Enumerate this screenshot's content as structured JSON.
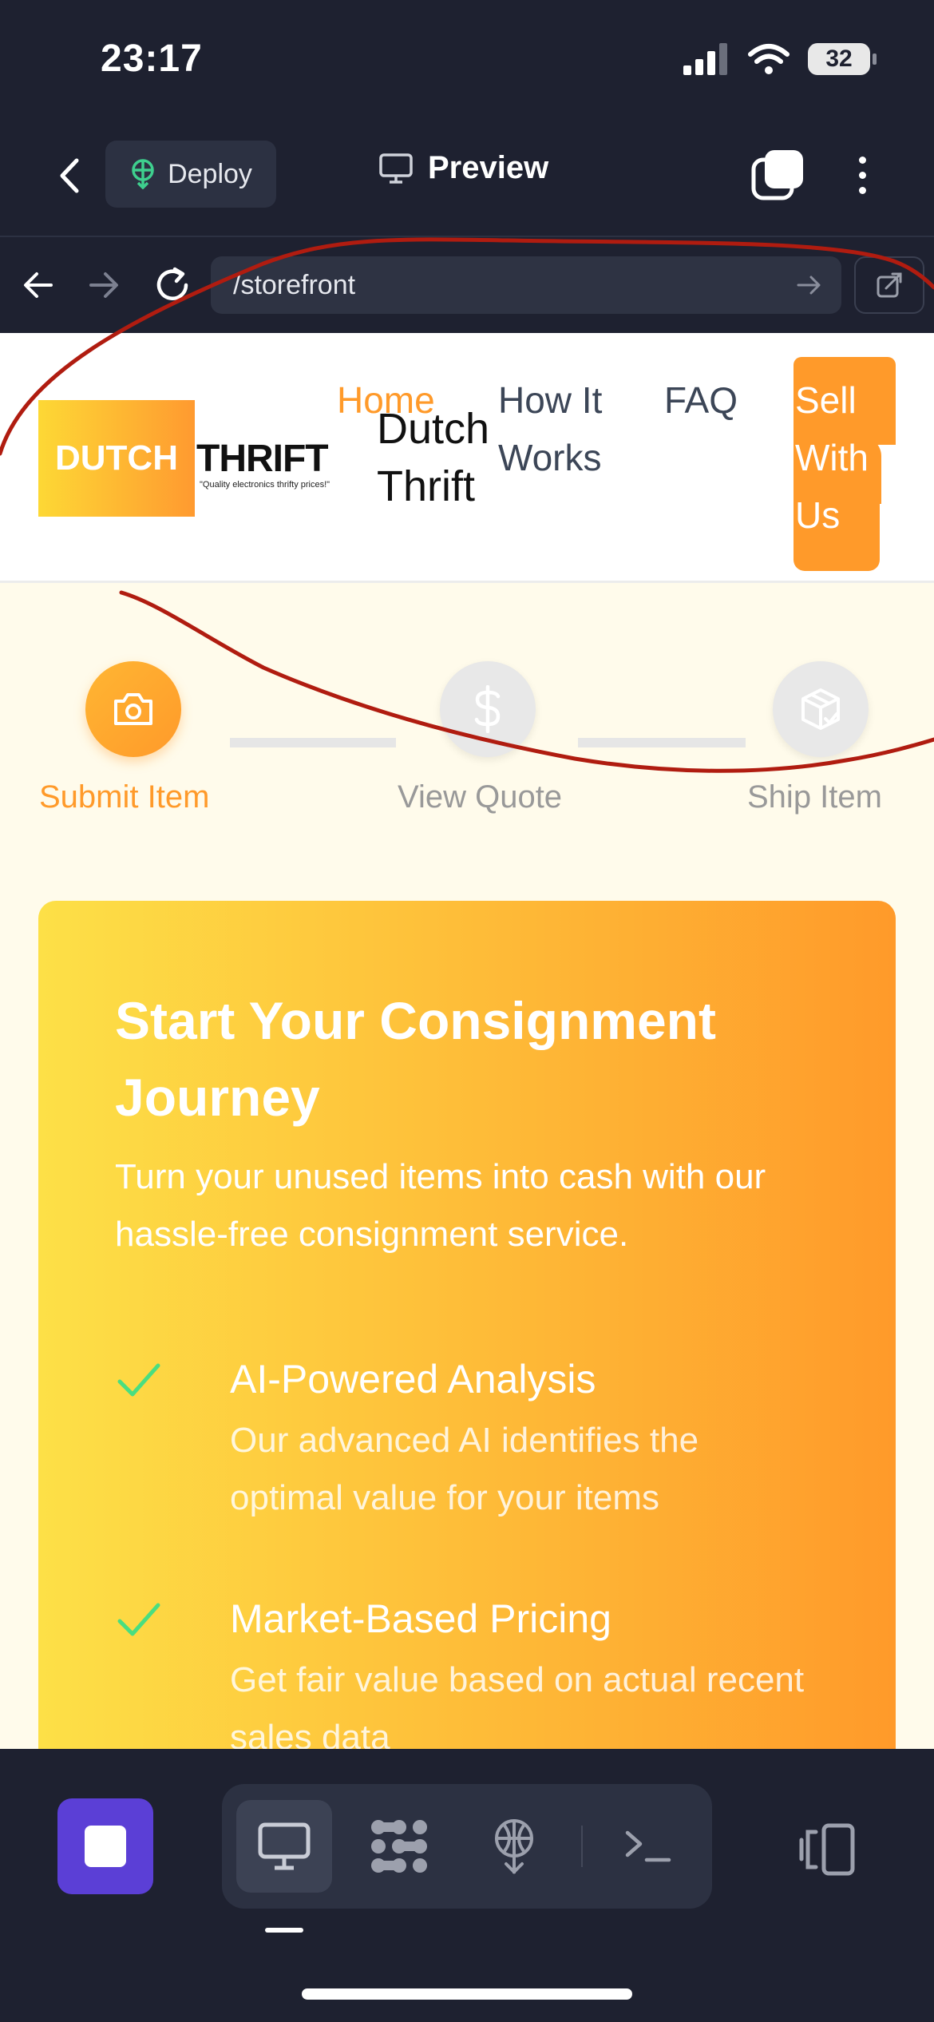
{
  "status_bar": {
    "time": "23:17",
    "battery": "32"
  },
  "app_bar": {
    "deploy_label": "Deploy",
    "preview_label": "Preview"
  },
  "browser": {
    "url": "/storefront"
  },
  "site": {
    "logo_word1": "DUTCH",
    "logo_word2": "THRIFT",
    "logo_tagline": "\"Quality electronics thrifty prices!\"",
    "brand_name": "Dutch Thrift",
    "nav": {
      "home": "Home",
      "how": "How It Works",
      "faq": "FAQ",
      "sell": "Sell With Us"
    }
  },
  "steps": [
    {
      "label": "Submit Item",
      "icon": "camera-icon",
      "active": true
    },
    {
      "label": "View Quote",
      "icon": "dollar-icon",
      "active": false
    },
    {
      "label": "Ship Item",
      "icon": "package-icon",
      "active": false
    }
  ],
  "card": {
    "title": "Start Your Consignment Journey",
    "description": "Turn your unused items into cash with our hassle-free consignment service.",
    "features": [
      {
        "title": "AI-Powered Analysis",
        "description": "Our advanced AI identifies the optimal value for your items"
      },
      {
        "title": "Market-Based Pricing",
        "description": "Get fair value based on actual recent sales data"
      }
    ]
  },
  "toolbar": {
    "items": [
      "desktop-icon",
      "apps-icon",
      "deploy-icon",
      "terminal-icon"
    ],
    "active": "desktop-icon"
  },
  "colors": {
    "accent": "#ff9a2a",
    "gradient_start": "#fde047",
    "stop_button": "#5b3fd6",
    "annotation": "#b01c10"
  }
}
